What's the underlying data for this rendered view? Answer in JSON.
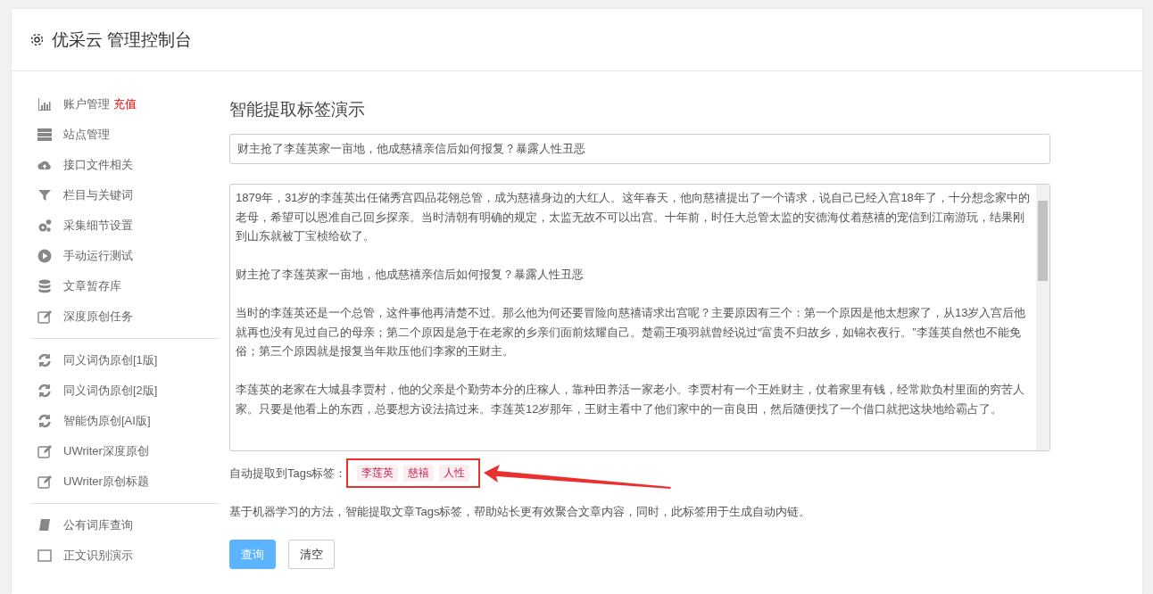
{
  "header": {
    "title": "优采云 管理控制台"
  },
  "sidebar": {
    "groups": [
      {
        "items": [
          {
            "label": "账户管理",
            "badge": "充值",
            "kind": "chart"
          },
          {
            "label": "站点管理",
            "kind": "server"
          },
          {
            "label": "接口文件相关",
            "kind": "cloud"
          },
          {
            "label": "栏目与关键词",
            "kind": "filter"
          },
          {
            "label": "采集细节设置",
            "kind": "gears"
          },
          {
            "label": "手动运行测试",
            "kind": "play"
          },
          {
            "label": "文章暂存库",
            "kind": "database"
          },
          {
            "label": "深度原创任务",
            "kind": "edit"
          }
        ]
      },
      {
        "items": [
          {
            "label": "同义词伪原创[1版]",
            "kind": "refresh"
          },
          {
            "label": "同义词伪原创[2版]",
            "kind": "refresh"
          },
          {
            "label": "智能伪原创[AI版]",
            "kind": "refresh"
          },
          {
            "label": "UWriter深度原创",
            "kind": "edit"
          },
          {
            "label": "UWriter原创标题",
            "kind": "edit"
          }
        ]
      },
      {
        "items": [
          {
            "label": "公有词库查询",
            "kind": "book"
          },
          {
            "label": "正文识别演示",
            "kind": "square"
          }
        ]
      }
    ]
  },
  "main": {
    "title": "智能提取标签演示",
    "title_field": {
      "value": "财主抢了李莲英家一亩地，他成慈禧亲信后如何报复？暴露人性丑恶"
    },
    "article": [
      "1879年，31岁的李莲英出任储秀宫四品花翎总管，成为慈禧身边的大红人。这年春天，他向慈禧提出了一个请求，说自己已经入宫18年了，十分想念家中的老母，希望可以恩准自己回乡探亲。当时清朝有明确的规定，太监无故不可以出宫。十年前，时任大总管太监的安德海仗着慈禧的宠信到江南游玩，结果刚到山东就被丁宝桢给砍了。",
      "财主抢了李莲英家一亩地，他成慈禧亲信后如何报复？暴露人性丑恶",
      "当时的李莲英还是一个总管，这件事他再清楚不过。那么他为何还要冒险向慈禧请求出宫呢？主要原因有三个：第一个原因是他太想家了，从13岁入宫后他就再也没有见过自己的母亲；第二个原因是急于在老家的乡亲们面前炫耀自己。楚霸王项羽就曾经说过“富贵不归故乡，如锦衣夜行。”李莲英自然也不能免俗；第三个原因就是报复当年欺压他们李家的王财主。",
      "李莲英的老家在大城县李贾村，他的父亲是个勤劳本分的庄稼人，靠种田养活一家老小。李贾村有一个王姓财主，仗着家里有钱，经常欺负村里面的穷苦人家。只要是他看上的东西，总要想方设法搞过来。李莲英12岁那年，王财主看中了他们家中的一亩良田，然后随便找了一个借口就把这块地给霸占了。"
    ],
    "tags_label": "自动提取到Tags标签：",
    "tags": [
      "李莲英",
      "慈禧",
      "人性"
    ],
    "description": "基于机器学习的方法，智能提取文章Tags标签，帮助站长更有效聚合文章内容，同时，此标签用于生成自动内链。",
    "buttons": [
      {
        "label": "查询",
        "kind": "primary"
      },
      {
        "label": "清空",
        "kind": "default"
      }
    ]
  }
}
